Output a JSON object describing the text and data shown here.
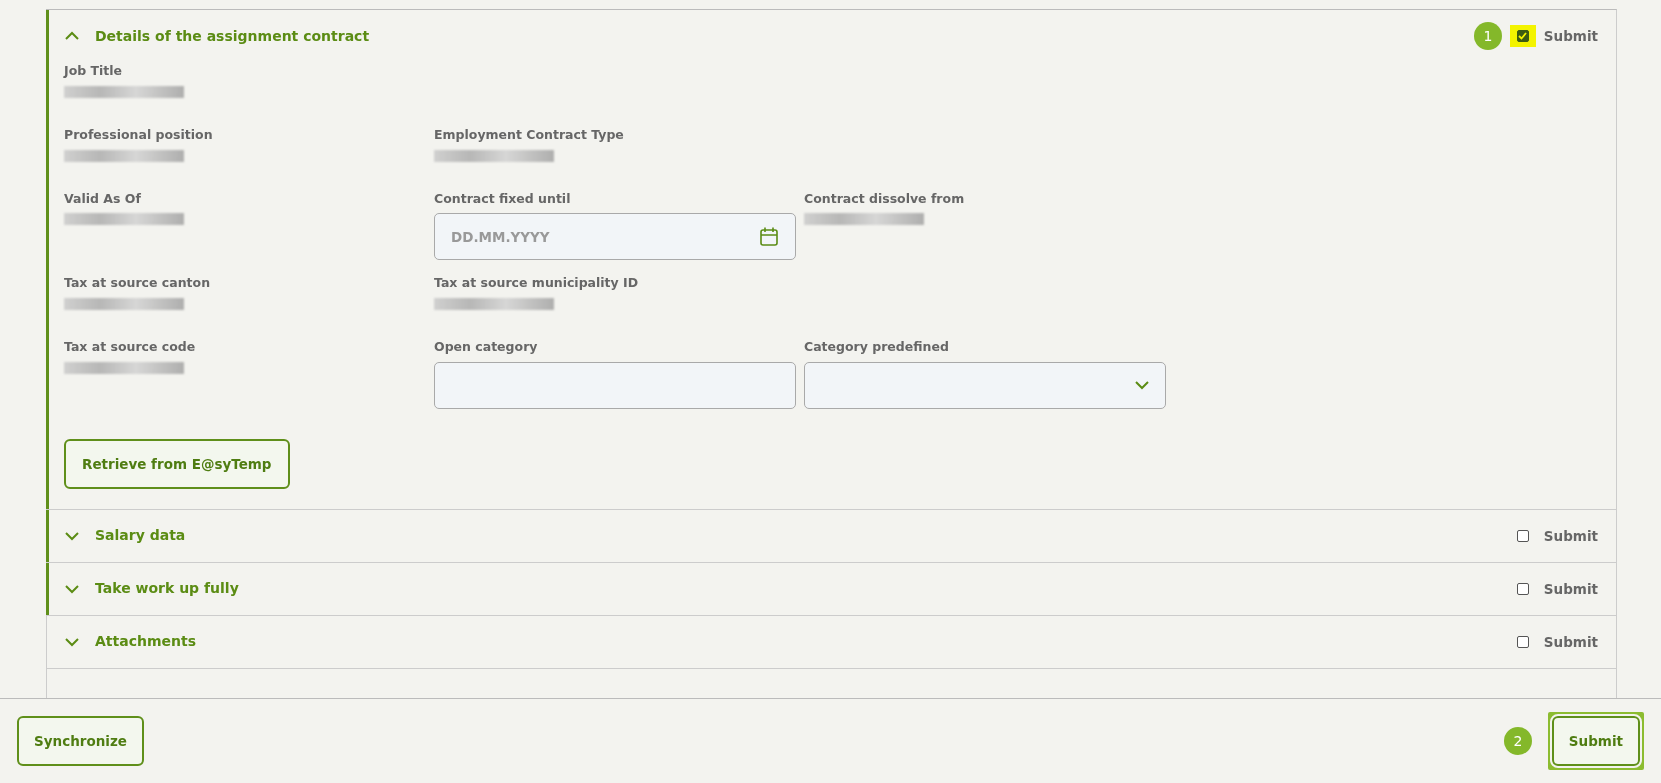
{
  "sections": [
    {
      "title": "Details of the assignment contract",
      "expanded": true,
      "highlighted": true,
      "submit": {
        "label": "Submit",
        "checked": true,
        "highlighted": true,
        "marker": "1"
      },
      "rows": [
        [
          {
            "kind": "value",
            "label": "Job Title"
          }
        ],
        [
          {
            "kind": "value",
            "label": "Professional position"
          },
          {
            "kind": "value",
            "label": "Employment Contract Type"
          }
        ],
        [
          {
            "kind": "value",
            "label": "Valid As Of"
          },
          {
            "kind": "date",
            "label": "Contract fixed until",
            "placeholder": "DD.MM.YYYY"
          },
          {
            "kind": "value",
            "label": "Contract dissolve from"
          }
        ],
        [
          {
            "kind": "value",
            "label": "Tax at source canton"
          },
          {
            "kind": "value",
            "label": "Tax at source municipality ID"
          }
        ],
        [
          {
            "kind": "value",
            "label": "Tax at source code"
          },
          {
            "kind": "text",
            "label": "Open category"
          },
          {
            "kind": "select",
            "label": "Category predefined"
          }
        ]
      ],
      "action": "Retrieve from E@syTemp"
    },
    {
      "title": "Salary data",
      "expanded": false,
      "highlighted": true,
      "submit": {
        "label": "Submit",
        "checked": false,
        "highlighted": false
      }
    },
    {
      "title": "Take work up fully",
      "expanded": false,
      "highlighted": true,
      "submit": {
        "label": "Submit",
        "checked": false,
        "highlighted": false
      }
    },
    {
      "title": "Attachments",
      "expanded": false,
      "highlighted": false,
      "submit": {
        "label": "Submit",
        "checked": false,
        "highlighted": false
      }
    }
  ],
  "footer": {
    "buttons": [
      {
        "label": "Synchronize",
        "outlined": false
      },
      {
        "label": "Submit",
        "outlined": true,
        "marker": "2"
      }
    ]
  }
}
